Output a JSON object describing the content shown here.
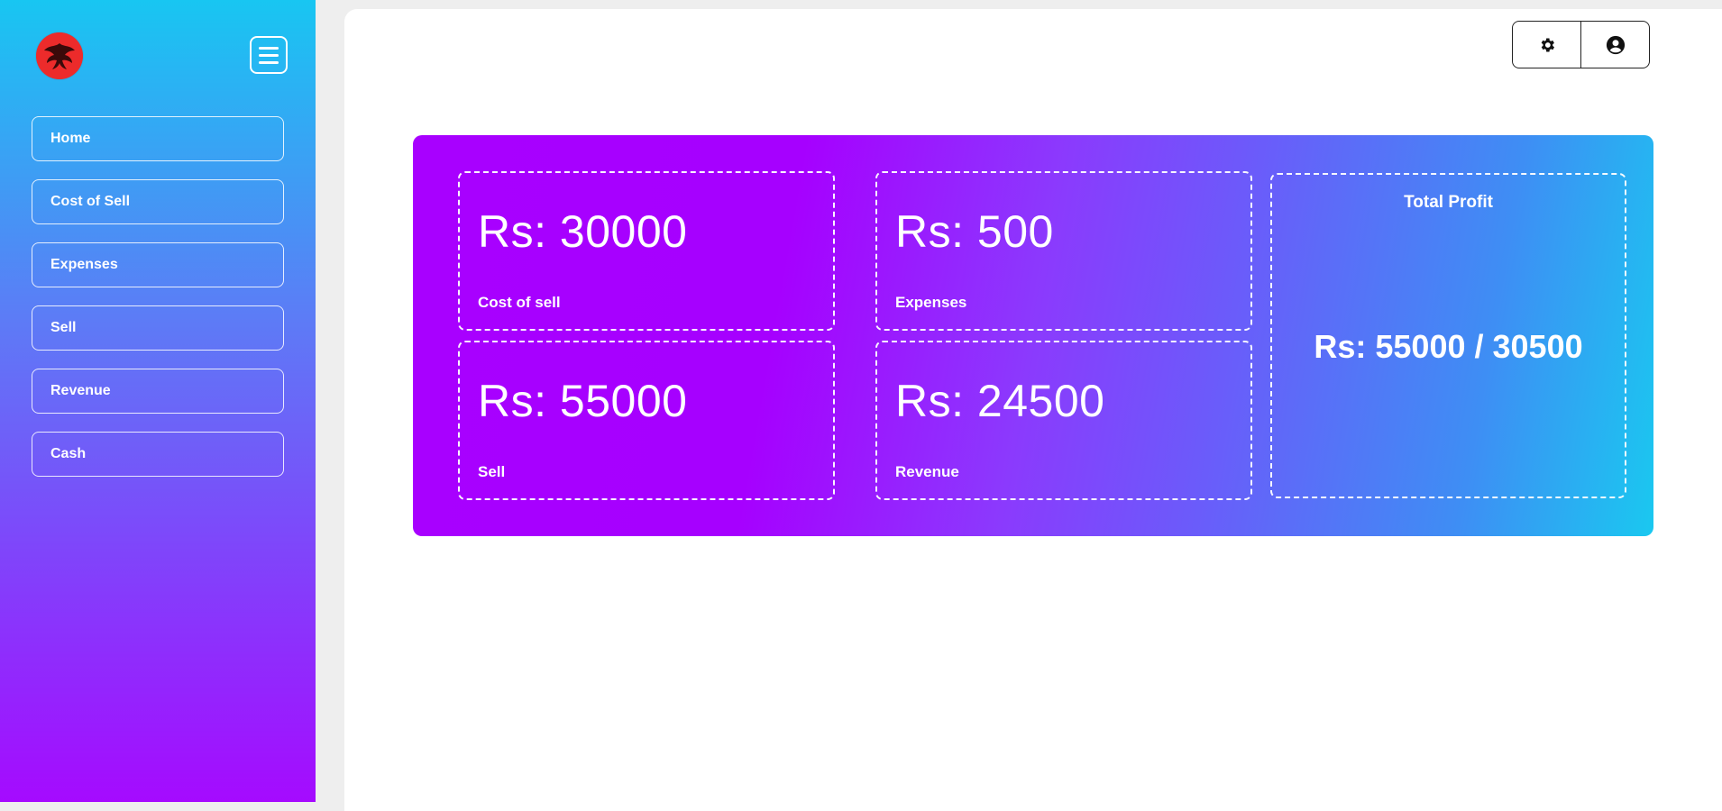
{
  "sidebar": {
    "logo_icon": "phoenix-logo-icon",
    "menu_icon": "hamburger-menu-icon",
    "items": [
      {
        "label": "Home"
      },
      {
        "label": "Cost of Sell"
      },
      {
        "label": "Expenses"
      },
      {
        "label": "Sell"
      },
      {
        "label": "Revenue"
      },
      {
        "label": "Cash"
      }
    ]
  },
  "header": {
    "settings_icon": "gear-icon",
    "profile_icon": "user-circle-icon"
  },
  "stats": {
    "cost_of_sell": {
      "amount": "Rs: 30000",
      "label": "Cost of sell"
    },
    "expenses": {
      "amount": "Rs: 500",
      "label": "Expenses"
    },
    "sell": {
      "amount": "Rs: 55000",
      "label": "Sell"
    },
    "revenue": {
      "amount": "Rs: 24500",
      "label": "Revenue"
    },
    "total_profit": {
      "title": "Total Profit",
      "value": "Rs: 55000 / 30500"
    }
  },
  "colors": {
    "sidebar_top": "#18c6f2",
    "sidebar_bottom": "#a50aff",
    "banner_start": "#a800ff",
    "banner_end": "#1ac8f0",
    "logo_bg": "#ec2b2b"
  }
}
